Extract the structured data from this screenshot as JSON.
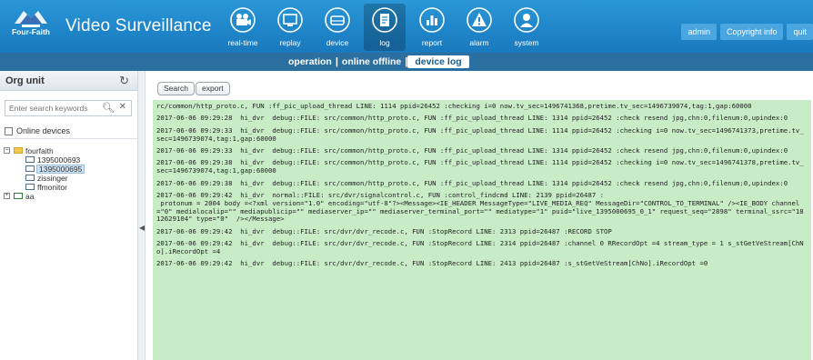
{
  "header": {
    "brand": "Four-Faith",
    "title": "Video Surveillance",
    "nav": [
      {
        "label": "real-time",
        "icon": "camera-icon"
      },
      {
        "label": "replay",
        "icon": "monitor-icon"
      },
      {
        "label": "device",
        "icon": "hard-drive-icon"
      },
      {
        "label": "log",
        "icon": "log-file-icon"
      },
      {
        "label": "report",
        "icon": "bar-chart-icon"
      },
      {
        "label": "alarm",
        "icon": "warning-icon"
      },
      {
        "label": "system",
        "icon": "user-icon"
      }
    ],
    "active_nav": "log",
    "user": "admin",
    "copyright": "Copyright info",
    "quit": "quit"
  },
  "subnav": {
    "operation": "operation",
    "online_offline": "online offline",
    "device_log": "device log",
    "sep": "|"
  },
  "sidebar": {
    "title": "Org unit",
    "search_placeholder": "Enter search keywords",
    "online_devices": "Online devices",
    "tree": {
      "root": "fourfaith",
      "children": [
        "1395000693",
        "1395000695",
        "zissinger",
        "ffmonitor"
      ],
      "selected": "1395000695",
      "other": "aa"
    }
  },
  "main": {
    "search_button": "Search",
    "export_button": "export",
    "log_entries": [
      "rc/common/http_proto.c, FUN :ff_pic_upload_thread LINE: 1114 ppid=26452 :checking i=0 now.tv_sec=1496741368,pretime.tv_sec=1496739074,tag:1,gap:60000",
      "2017-06-06 09:29:28  hi_dvr  debug::FILE: src/common/http_proto.c, FUN :ff_pic_upload_thread LINE: 1314 ppid=26452 :check resend jpg,chn:0,filenum:0,upindex:0",
      "2017-06-06 09:29:33  hi_dvr  debug::FILE: src/common/http_proto.c, FUN :ff_pic_upload_thread LINE: 1114 ppid=26452 :checking i=0 now.tv_sec=1496741373,pretime.tv_sec=1496739074,tag:1,gap:60000",
      "2017-06-06 09:29:33  hi_dvr  debug::FILE: src/common/http_proto.c, FUN :ff_pic_upload_thread LINE: 1314 ppid=26452 :check resend jpg,chn:0,filenum:0,upindex:0",
      "2017-06-06 09:29:38  hi_dvr  debug::FILE: src/common/http_proto.c, FUN :ff_pic_upload_thread LINE: 1114 ppid=26452 :checking i=0 now.tv_sec=1496741378,pretime.tv_sec=1496739074,tag:1,gap:60000",
      "2017-06-06 09:29:38  hi_dvr  debug::FILE: src/common/http_proto.c, FUN :ff_pic_upload_thread LINE: 1314 ppid=26452 :check resend jpg,chn:0,filenum:0,upindex:0",
      "2017-06-06 09:29:42  hi_dvr  normal::FILE: src/dvr/signalcontrol.c, FUN :control_findcmd LINE: 2139 ppid=26487 :\n protonum = 2004 body =<?xml version=\"1.0\" encoding=\"utf-8\"?><Message><IE_HEADER MessageType=\"LIVE_MEDIA_REQ\" MessageDir=\"CONTROL_TO_TERMINAL\" /><IE_BODY channel=\"0\" medialocalip=\"\" mediapublicip=\"\" mediaserver_ip=\"\" mediaserver_terminal_port=\"\" mediatype=\"1\" puid=\"live_1395000695_0_1\" request_seq=\"2898\" terminal_ssrc=\"1812629104\" type=\"0\"  /></Message>",
      "2017-06-06 09:29:42  hi_dvr  debug::FILE: src/dvr/dvr_recode.c, FUN :StopRecord LINE: 2313 ppid=26487 :RECORD STOP",
      "2017-06-06 09:29:42  hi_dvr  debug::FILE: src/dvr/dvr_recode.c, FUN :StopRecord LINE: 2314 ppid=26487 :channel 0 RRecordOpt =4 stream_type = 1 s_stGetVeStream[ChNo].iRecordOpt =4",
      "2017-06-06 09:29:42  hi_dvr  debug::FILE: src/dvr/dvr_recode.c, FUN :StopRecord LINE: 2413 ppid=26487 :s_stGetVeStream[ChNo].iRecordOpt =0"
    ]
  },
  "colors": {
    "header_blue": "#1f86c9",
    "subnav_blue": "#2a6fa0",
    "log_bg": "#c8edc6"
  }
}
